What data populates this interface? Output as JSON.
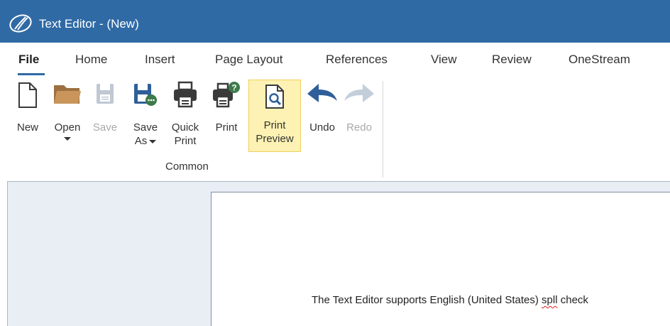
{
  "window": {
    "title": "Text Editor - (New)",
    "logo_icon": "onestream-logo-icon"
  },
  "menu": {
    "active": "File",
    "items": [
      "File",
      "Home",
      "Insert",
      "Page Layout",
      "References",
      "View",
      "Review",
      "OneStream"
    ]
  },
  "ribbon": {
    "group_label": "Common",
    "buttons": {
      "new": {
        "line1": "New",
        "line2": "",
        "icon": "new-document-icon",
        "enabled": true
      },
      "open": {
        "line1": "Open",
        "line2": "",
        "icon": "folder-icon",
        "enabled": true,
        "has_dropdown": true
      },
      "save": {
        "line1": "Save",
        "line2": "",
        "icon": "save-icon",
        "enabled": false
      },
      "save_as": {
        "line1": "Save",
        "line2": "As",
        "icon": "save-as-icon",
        "enabled": true,
        "has_dropdown": true
      },
      "quick_print": {
        "line1": "Quick",
        "line2": "Print",
        "icon": "printer-icon",
        "enabled": true
      },
      "print": {
        "line1": "Print",
        "line2": "",
        "icon": "print-dialog-icon",
        "enabled": true
      },
      "print_preview": {
        "line1": "Print",
        "line2": "Preview",
        "icon": "print-preview-icon",
        "enabled": true,
        "selected": true
      },
      "undo": {
        "line1": "Undo",
        "line2": "",
        "icon": "undo-icon",
        "enabled": true
      },
      "redo": {
        "line1": "Redo",
        "line2": "",
        "icon": "redo-icon",
        "enabled": false
      }
    }
  },
  "document": {
    "text_before": "The Text Editor supports English (United States) ",
    "misspelled": "spll",
    "text_after": " check"
  },
  "colors": {
    "titlebar": "#2f6aa5",
    "highlight_bg": "#fdf2b3",
    "highlight_border": "#f0cf5c",
    "icon_blue": "#2f5f9a",
    "icon_gray": "#3a3a3a",
    "folder": "#c9955a",
    "disabled": "#a9a9a9",
    "spell_error": "#e02020"
  }
}
